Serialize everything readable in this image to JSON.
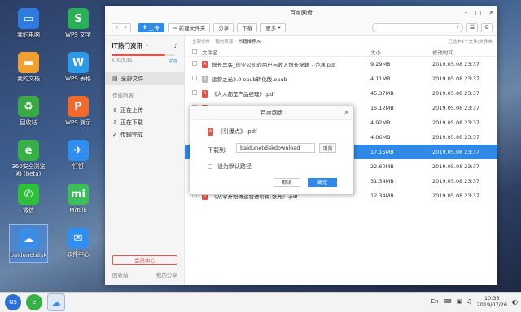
{
  "desktop": {
    "icons": [
      {
        "label": "我的电脑",
        "icon": "computer-icon",
        "color": "#2f7be0"
      },
      {
        "label": "WPS 文字",
        "icon": "wps-writer-icon",
        "color": "#2bb05a"
      },
      {
        "label": "我的文档",
        "icon": "folder-icon",
        "color": "#f0a030"
      },
      {
        "label": "WPS 表格",
        "icon": "wps-sheet-icon",
        "color": "#2e9ae6"
      },
      {
        "label": "回收站",
        "icon": "recycle-bin-icon",
        "color": "#3aa845"
      },
      {
        "label": "WPS 演示",
        "icon": "wps-slides-icon",
        "color": "#f06a2a"
      },
      {
        "label": "360安全浏览器 (beta)",
        "icon": "browser-360-icon",
        "color": "#38b048"
      },
      {
        "label": "钉钉",
        "icon": "dingtalk-icon",
        "color": "#2f8ef0"
      },
      {
        "label": "微信",
        "icon": "wechat-icon",
        "color": "#2fbf3a"
      },
      {
        "label": "MiTalk",
        "icon": "mitalk-icon",
        "color": "#3cbf5a"
      },
      {
        "label": "baidunetdisk",
        "icon": "baidunetdisk-icon",
        "color": "#3a8ee6"
      },
      {
        "label": "软件中心",
        "icon": "software-center-icon",
        "color": "#2f8ef0"
      }
    ]
  },
  "taskbar": {
    "start_label": "NS",
    "lang": "En",
    "time": "10:33",
    "date": "2019/07/26"
  },
  "window": {
    "title": "百度网盘",
    "toolbar": {
      "upload": "上传",
      "new_folder": "新建文件夹",
      "share": "分享",
      "download": "下载",
      "more": "更多"
    },
    "sidebar": {
      "brand": "IT热门资讯",
      "quota_used_fraction": 0.85,
      "quota_text": "4.0G/5.0G",
      "expand": "扩容",
      "all_files": "全部文件",
      "transfer_head": "传输列表",
      "uploading": "正在上传",
      "downloading": "正在下载",
      "done": "传输完成",
      "vip": "会员中心",
      "recycle": "回收站",
      "my_share": "我的分享"
    },
    "breadcrumb": [
      "全部文件",
      "我的资源",
      "书籍推荐.M"
    ],
    "loaded_info": "已选中1个文件/文件夹",
    "columns": {
      "name": "文件名",
      "size": "大小",
      "date": "修改时间"
    },
    "files": [
      {
        "name": "增长黑客_创业公司的用户与收入增长秘籍 - 范冰.pdf",
        "size": "9.29MB",
        "date": "2019.05.08 23:37",
        "type": "pdf"
      },
      {
        "name": "运营之光2.0 epub转化版.epub",
        "size": "4.11MB",
        "date": "2019.05.08 23:37",
        "type": "epub"
      },
      {
        "name": "《人人都是产品经理》.pdf",
        "size": "45.37MB",
        "date": "2019.05.08 23:37",
        "type": "pdf"
      },
      {
        "name": "",
        "size": "15.12MB",
        "date": "2019.05.08 23:37",
        "type": "pdf"
      },
      {
        "name": "",
        "size": "4.92MB",
        "date": "2019.05.08 23:37",
        "type": "pdf"
      },
      {
        "name": "",
        "size": "4.06MB",
        "date": "2019.05.08 23:37",
        "type": "pdf"
      },
      {
        "name": "",
        "size": "17.15MB",
        "date": "2019.05.08 23:37",
        "type": "pdf",
        "selected": true
      },
      {
        "name": "",
        "size": "22.60MB",
        "date": "2019.05.08 23:37",
        "type": "pdf"
      },
      {
        "name": "金字塔原理.pdf",
        "size": "31.34MB",
        "date": "2019.05.08 23:37",
        "type": "pdf"
      },
      {
        "name": "《从零开始做运营进阶篇.张亮》.pdf",
        "size": "12.34MB",
        "date": "2019.05.08 23:37",
        "type": "pdf"
      }
    ]
  },
  "dialog": {
    "title": "百度网盘",
    "file_name": "《引爆点》.pdf",
    "download_to_label": "下载到:",
    "path_value": "baidunetdiskdownload",
    "browse": "浏览",
    "default_path": "设为默认路径",
    "cancel": "取消",
    "ok": "确定"
  }
}
